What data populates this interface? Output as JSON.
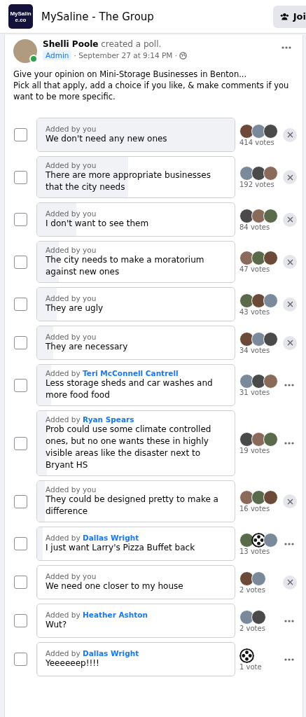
{
  "header": {
    "logo_text": "MySaline.co",
    "title": "MySaline - The Group",
    "join_button": "Joi"
  },
  "post": {
    "author": "Shelli Poole",
    "action": "created a poll.",
    "online": true,
    "badge": "Admin",
    "time": "· September 27 at 9:14 PM ·",
    "text": [
      "Give your opinion on Mini-Storage Businesses in Benton...",
      "Pick all that apply, add a choice if you like, & make comments if you want to be more specific."
    ]
  },
  "options": [
    {
      "kind": "own",
      "added_by": "Added by you",
      "text": "We don't need any new ones",
      "votes": "414 votes",
      "level": 1.0,
      "checked": false,
      "avatars": [
        {
          "kind": "photo"
        },
        {
          "kind": "photo"
        },
        {
          "kind": "photo"
        }
      ]
    },
    {
      "kind": "own",
      "added_by": "Added by you",
      "text": "There are more appropriate businesses that the city needs",
      "votes": "192 votes",
      "level": 0.46,
      "checked": false,
      "avatars": [
        {
          "kind": "photo"
        },
        {
          "kind": "photo"
        },
        {
          "kind": "photo"
        }
      ]
    },
    {
      "kind": "own",
      "added_by": "Added by you",
      "text": "I don't want to see them",
      "votes": "84 votes",
      "level": 0.2,
      "checked": false,
      "avatars": [
        {
          "kind": "photo"
        },
        {
          "kind": "photo"
        },
        {
          "kind": "photo"
        }
      ]
    },
    {
      "kind": "own",
      "added_by": "Added by you",
      "text": "The city needs to make a moratorium against new ones",
      "votes": "47 votes",
      "level": 0.11,
      "checked": false,
      "avatars": [
        {
          "kind": "photo"
        },
        {
          "kind": "photo"
        },
        {
          "kind": "photo"
        }
      ]
    },
    {
      "kind": "own",
      "added_by": "Added by you",
      "text": "They are ugly",
      "votes": "43 votes",
      "level": 0.1,
      "checked": false,
      "avatars": [
        {
          "kind": "photo"
        },
        {
          "kind": "photo"
        },
        {
          "kind": "photo"
        }
      ]
    },
    {
      "kind": "own",
      "added_by": "Added by you",
      "text": "They are necessary",
      "votes": "34 votes",
      "level": 0.08,
      "checked": false,
      "avatars": [
        {
          "kind": "photo"
        },
        {
          "kind": "photo"
        },
        {
          "kind": "photo"
        }
      ]
    },
    {
      "kind": "other",
      "added_label": "Added by",
      "author": "Teri McConnell Cantrell",
      "text": "Less storage sheds and car washes and more food food",
      "votes": "31 votes",
      "level": 0.07,
      "checked": false,
      "avatars": [
        {
          "kind": "photo"
        },
        {
          "kind": "photo"
        },
        {
          "kind": "photo"
        }
      ]
    },
    {
      "kind": "other",
      "added_label": "Added by",
      "author": "Ryan Spears",
      "text": "Prob could use some climate controlled ones, but no one wants these in highly visible areas like the disaster next to Bryant HS",
      "votes": "19 votes",
      "level": 0.05,
      "checked": false,
      "avatars": [
        {
          "kind": "photo"
        },
        {
          "kind": "photo"
        },
        {
          "kind": "photo"
        }
      ]
    },
    {
      "kind": "own",
      "added_by": "Added by you",
      "text": "They could be designed pretty to make a difference",
      "votes": "16 votes",
      "level": 0.04,
      "checked": false,
      "avatars": [
        {
          "kind": "photo"
        },
        {
          "kind": "photo"
        },
        {
          "kind": "photo"
        }
      ]
    },
    {
      "kind": "other",
      "added_label": "Added by",
      "author": "Dallas Wright",
      "text": "I just want Larry's Pizza Buffet back",
      "votes": "13 votes",
      "level": 0.03,
      "checked": false,
      "avatars": [
        {
          "kind": "photo"
        },
        {
          "kind": "reel"
        },
        {
          "kind": "photo"
        }
      ]
    },
    {
      "kind": "own",
      "added_by": "Added by you",
      "text": "We need one closer to my house",
      "votes": "2 votes",
      "level": 0.005,
      "checked": false,
      "avatars": [
        {
          "kind": "photo"
        },
        {
          "kind": "photo"
        }
      ]
    },
    {
      "kind": "other",
      "added_label": "Added by",
      "author": "Heather Ashton",
      "text": "Wut?",
      "votes": "2 votes",
      "level": 0.005,
      "checked": false,
      "avatars": [
        {
          "kind": "photo"
        },
        {
          "kind": "photo"
        }
      ]
    },
    {
      "kind": "other",
      "added_label": "Added by",
      "author": "Dallas Wright",
      "text": "Yeeeeeep!!!!",
      "votes": "1 vote",
      "level": 0.003,
      "checked": false,
      "avatars": [
        {
          "kind": "reel"
        }
      ]
    }
  ]
}
